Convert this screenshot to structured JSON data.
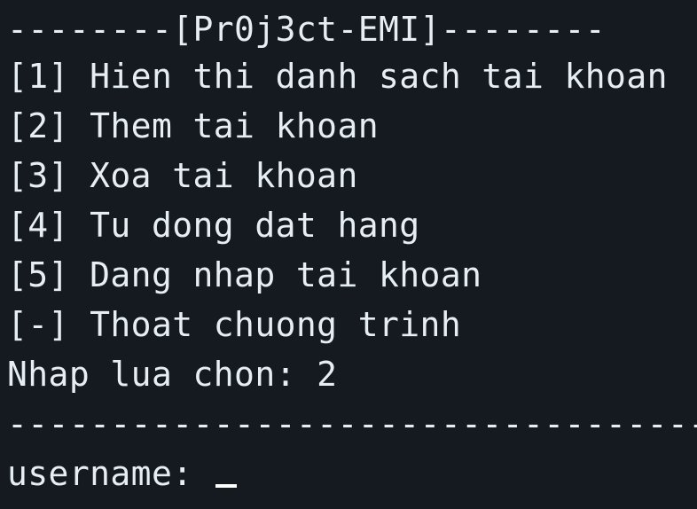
{
  "terminal": {
    "header": "--------[Pr0j3ct-EMI]--------",
    "menu": [
      "[1] Hien thi danh sach tai khoan",
      "[2] Them tai khoan",
      "[3] Xoa tai khoan",
      "[4] Tu dong dat hang",
      "[5] Dang nhap tai khoan",
      "[-] Thoat chuong trinh"
    ],
    "choice_prompt": "Nhap lua chon: 2",
    "separator": "----------------------------------",
    "input_label": "username: "
  }
}
